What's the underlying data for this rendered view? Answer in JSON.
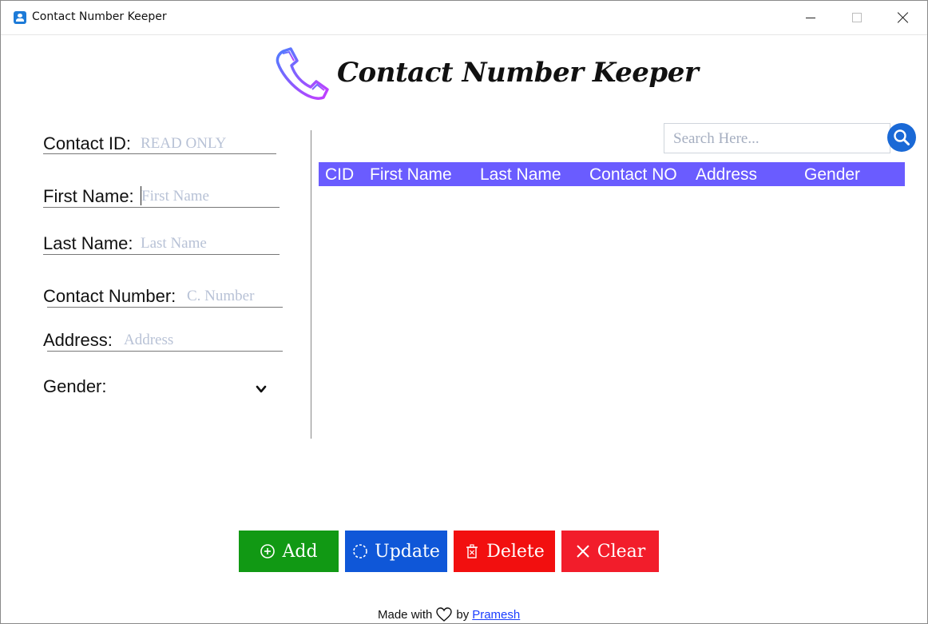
{
  "window": {
    "title": "Contact Number Keeper",
    "icons": {
      "app": "contacts-app-icon",
      "minimize": "minimize-icon",
      "maximize": "maximize-icon",
      "close": "close-icon"
    }
  },
  "header": {
    "title": "Contact Number Keeper",
    "logo": "phone-handset-icon",
    "logo_colors": [
      "#4f7dff",
      "#c43cff"
    ]
  },
  "form": {
    "contact_id": {
      "label": "Contact ID:",
      "placeholder": "READ ONLY"
    },
    "first_name": {
      "label": "First Name:",
      "placeholder": "First Name"
    },
    "last_name": {
      "label": "Last Name:",
      "placeholder": "Last Name"
    },
    "contact_number": {
      "label": "Contact Number:",
      "placeholder": "C. Number"
    },
    "address": {
      "label": "Address:",
      "placeholder": "Address"
    },
    "gender": {
      "label": "Gender:",
      "value": "",
      "icon": "chevron-down-icon"
    }
  },
  "search": {
    "placeholder": "Search Here...",
    "icon": "search-icon"
  },
  "table": {
    "headers": [
      "CID",
      "First Name",
      "Last Name",
      "Contact NO",
      "Address",
      "Gender"
    ],
    "rows": [],
    "header_color": "#6a5cff"
  },
  "buttons": {
    "add": {
      "label": "Add",
      "icon": "plus-circle-icon",
      "color": "#119914"
    },
    "update": {
      "label": "Update",
      "icon": "refresh-icon",
      "color": "#0f57d8"
    },
    "delete": {
      "label": "Delete",
      "icon": "trash-icon",
      "color": "#f20f0f"
    },
    "clear": {
      "label": "Clear",
      "icon": "close-icon",
      "color": "#f21d2b"
    }
  },
  "footer": {
    "prefix": "Made with",
    "icon": "heart-icon",
    "by": "by",
    "author": "Pramesh"
  }
}
